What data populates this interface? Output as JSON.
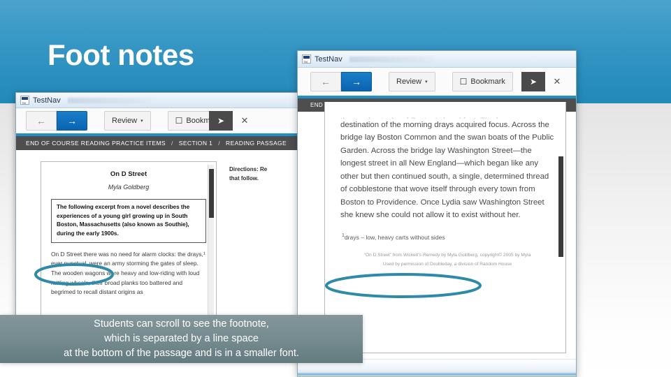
{
  "slide": {
    "title": "Foot notes",
    "colors": {
      "header_blue": "#2189b8",
      "accent_blue": "#1f8fc4",
      "annotation_teal": "#2e8aa8",
      "caption_bg": "#6d8488"
    }
  },
  "caption": {
    "line1": "Students can scroll to see the footnote,",
    "line2": "which is separated by a line space",
    "line3": "at the bottom of the passage and is in a smaller font."
  },
  "window_left": {
    "app_title": "TestNav",
    "toolbar": {
      "prev_label": "←",
      "next_label": "→",
      "review_label": "Review",
      "review_caret": "▾",
      "bookmark_label": "Bookmark",
      "bookmark_glyph": "☐",
      "pointer_tool": "➤",
      "close_tool": "✕"
    },
    "breadcrumb": {
      "item1": "END OF COURSE READING PRACTICE ITEMS",
      "sep": "/",
      "item2": "SECTION 1",
      "item3": "READING PASSAGE"
    },
    "passage": {
      "title": "On D Street",
      "author": "Myla Goldberg",
      "intro": "The following excerpt from a novel describes the experiences of a young girl growing up in South Boston, Massachusetts (also known as Southie), during the early 1900s.",
      "body": "On D Street there was no need for alarm clocks: the drays,¹ ever punctual, were an army storming the gates of sleep. The wooden wagons were heavy and low-riding with loud rattling wheels, their broad planks too battered and begrimed to recall distant origins as"
    },
    "directions": {
      "line1": "Directions: Re",
      "line2": "that follow."
    }
  },
  "window_right": {
    "app_title": "TestNav",
    "toolbar": {
      "prev_label": "←",
      "next_label": "→",
      "review_label": "Review",
      "review_caret": "▾",
      "bookmark_label": "Bookmark",
      "bookmark_glyph": "☐",
      "pointer_tool": "➤",
      "close_tool": "✕"
    },
    "breadcrumb": {
      "item1": "END OF COURSE READING PRACTICE ITEMS",
      "sep": "/",
      "item2": "SECTION 1",
      "item3": "READING PASSAGE"
    },
    "passage": {
      "clipped_line": "the smokestacks of Boston's breakfast. The hazy",
      "body": "destination of the morning drays acquired focus. Across the bridge lay Boston Common and the swan boats of the Public Garden. Across the bridge lay Washington Street—the longest street in all New England—which began like any other but then continued south, a single, determined thread of cobblestone that wove itself through every town from Boston to Providence. Once Lydia saw Washington Street she knew she could not allow it to exist without her.",
      "footnote_marker": "1",
      "footnote_text": "drays – low, heavy carts without sides",
      "copyright_line1_a": "“On D Street” from ",
      "copyright_line1_italic": "Wickett’s Remedy",
      "copyright_line1_b": " by Myla Goldberg, copyright© 2005 by Myla",
      "copyright_line2": "Used by permission of Doubleday, a division of Random House"
    }
  },
  "annotations": {
    "left_ellipse_target": "drays,¹",
    "right_ellipse_target": "¹drays – low, heavy carts without sides"
  }
}
